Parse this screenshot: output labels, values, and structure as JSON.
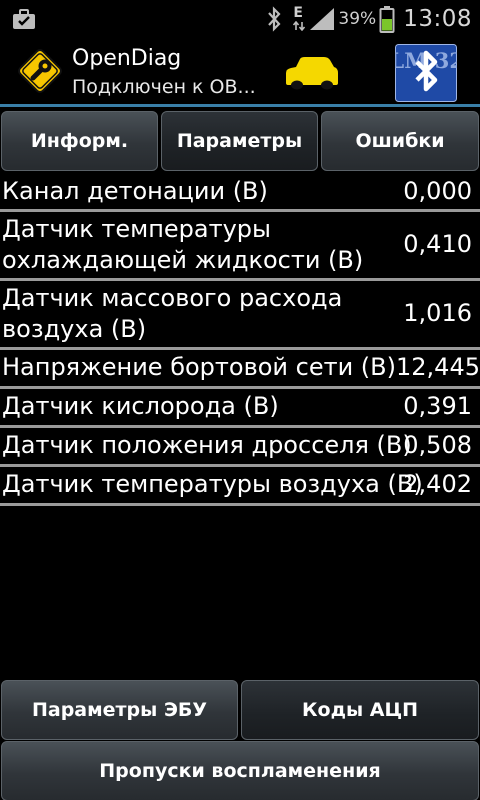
{
  "status_bar": {
    "network_type": "E",
    "battery_percent": "39%",
    "time": "13:08",
    "icons": [
      "briefcase-icon",
      "bluetooth-icon",
      "signal-icon",
      "battery-icon"
    ]
  },
  "app": {
    "title": "OpenDiag",
    "subtitle": "Подключен к OB...",
    "elm_label": "ELM 327",
    "colors": {
      "accent_line": "#3a7fa8",
      "car": "#f5d800",
      "logo": "#f7c600"
    }
  },
  "tabs": [
    {
      "label": "Информ.",
      "selected": false
    },
    {
      "label": "Параметры",
      "selected": true
    },
    {
      "label": "Ошибки",
      "selected": false
    }
  ],
  "parameters": [
    {
      "name": "Канал детонации (В)",
      "value": "0,000"
    },
    {
      "name": "Датчик температуры охлаждающей жидкости (В)",
      "value": "0,410"
    },
    {
      "name": "Датчик массового расхода воздуха (В)",
      "value": "1,016"
    },
    {
      "name": "Напряжение бортовой сети (В)",
      "value": "12,445"
    },
    {
      "name": "Датчик кислорода (В)",
      "value": "0,391"
    },
    {
      "name": "Датчик положения дросселя (В)",
      "value": "0,508"
    },
    {
      "name": "Датчик температуры воздуха (В)",
      "value": "2,402"
    }
  ],
  "bottom_buttons": {
    "ecu_params": "Параметры ЭБУ",
    "adc_codes": "Коды АЦП",
    "misfires": "Пропуски воспламенения"
  }
}
